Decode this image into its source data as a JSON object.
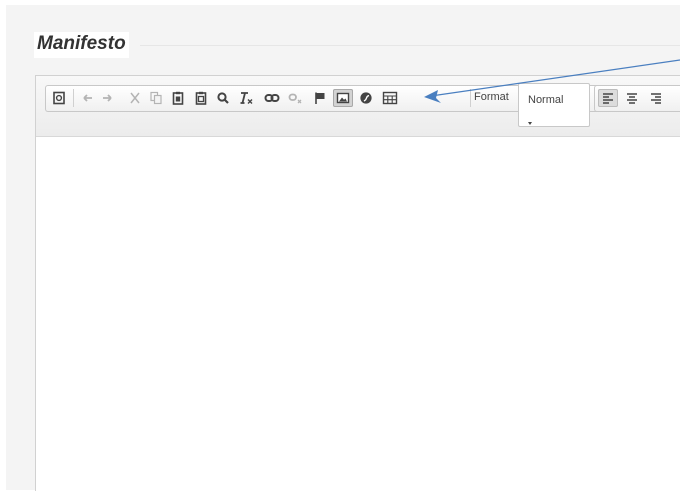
{
  "section": {
    "title": "Manifesto"
  },
  "toolbar": {
    "format_label": "Format",
    "format_value": "Normal",
    "buttons": [
      {
        "name": "source-icon"
      },
      {
        "name": "undo-icon"
      },
      {
        "name": "redo-icon"
      },
      {
        "name": "cut-icon"
      },
      {
        "name": "copy-icon"
      },
      {
        "name": "paste-icon"
      },
      {
        "name": "paste-text-icon"
      },
      {
        "name": "find-icon"
      },
      {
        "name": "remove-format-icon"
      },
      {
        "name": "link-icon"
      },
      {
        "name": "unlink-icon"
      },
      {
        "name": "anchor-flag-icon"
      },
      {
        "name": "image-icon"
      },
      {
        "name": "flash-icon"
      },
      {
        "name": "table-icon"
      },
      {
        "name": "align-left-icon"
      },
      {
        "name": "align-center-icon"
      },
      {
        "name": "align-right-icon"
      }
    ]
  },
  "colors": {
    "annotation_arrow": "#4a7fc0",
    "icon": "#444444",
    "icon_disabled": "#b4b4b4"
  }
}
